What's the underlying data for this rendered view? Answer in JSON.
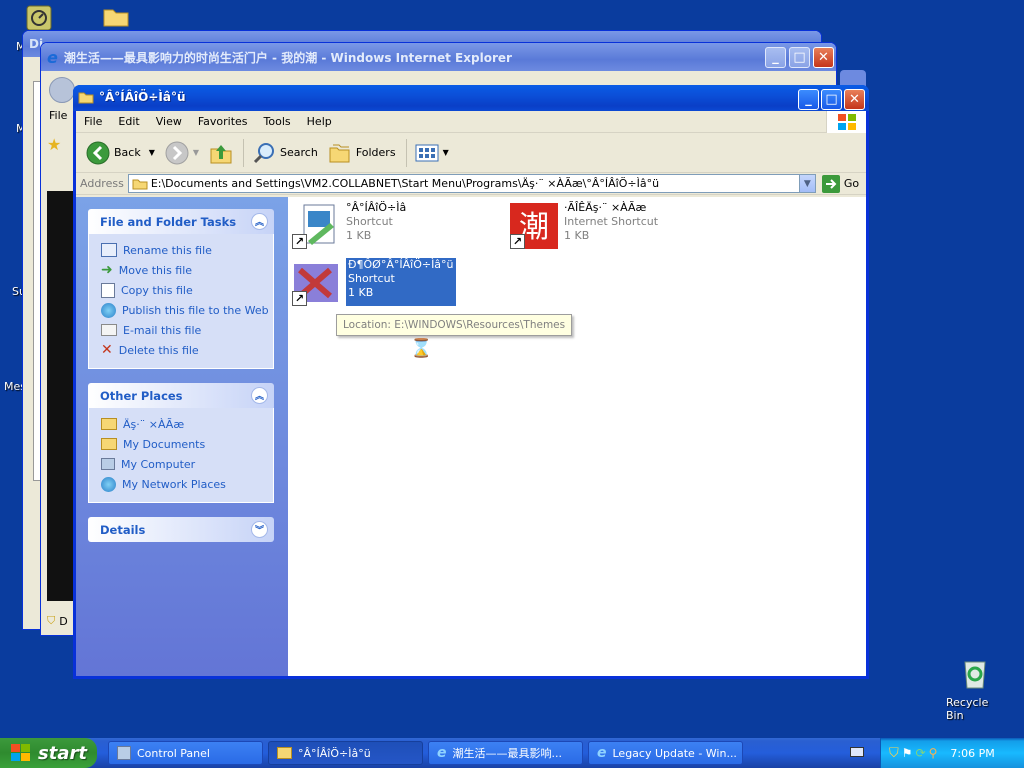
{
  "desktop": {
    "recycle_bin_label": "Recycle Bin",
    "left_stubs": [
      "M",
      "M",
      "Su",
      "Mes"
    ]
  },
  "bg_windows": {
    "back_title": "Di",
    "ie_title": "潮生活——最具影响力的时尚生活门户 - 我的潮 - Windows Internet Explorer",
    "ie_menu_stub": "File",
    "ie_status_stub": "D"
  },
  "explorer": {
    "title": "°Â°ÍÂîÖ÷Ìâ°ü",
    "menu": [
      "File",
      "Edit",
      "View",
      "Favorites",
      "Tools",
      "Help"
    ],
    "toolbar": {
      "back": "Back",
      "search": "Search",
      "folders": "Folders"
    },
    "address": {
      "label": "Address",
      "value": "E:\\Documents and Settings\\VM2.COLLABNET\\Start Menu\\Programs\\Äş·¨ ×ÀÃæ\\°Â°ÍÂîÖ÷Ìâ°ü",
      "go": "Go"
    },
    "file_tasks": {
      "title": "File and Folder Tasks",
      "items": [
        {
          "label": "Rename this file",
          "icon": "rename-icon"
        },
        {
          "label": "Move this file",
          "icon": "move-icon"
        },
        {
          "label": "Copy this file",
          "icon": "copy-icon"
        },
        {
          "label": "Publish this file to the Web",
          "icon": "globe-icon"
        },
        {
          "label": "E-mail this file",
          "icon": "email-icon"
        },
        {
          "label": "Delete this file",
          "icon": "delete-icon"
        }
      ]
    },
    "other_places": {
      "title": "Other Places",
      "items": [
        {
          "label": "Äş·¨ ×ÀÃæ",
          "icon": "folder-icon"
        },
        {
          "label": "My Documents",
          "icon": "my-documents-icon"
        },
        {
          "label": "My Computer",
          "icon": "my-computer-icon"
        },
        {
          "label": "My Network Places",
          "icon": "network-places-icon"
        }
      ]
    },
    "details": {
      "title": "Details"
    },
    "files": [
      {
        "name": "°Â°ÍÂîÖ÷Ìâ",
        "type": "Shortcut",
        "size": "1 KB"
      },
      {
        "name": "·ÃÎÊÄş·¨ ×ÀÃæ",
        "type": "Internet Shortcut",
        "size": "1 KB"
      },
      {
        "name": "Ð¶ÔØ°Â°ÍÂîÖ÷Ìâ°ü",
        "type": "Shortcut",
        "size": "1 KB"
      }
    ],
    "tooltip": "Location: E:\\WINDOWS\\Resources\\Themes"
  },
  "taskbar": {
    "start": "start",
    "tasks": [
      {
        "label": "Control Panel"
      },
      {
        "label": "°Â°ÍÂîÖ÷Ìâ°ü"
      },
      {
        "label": "潮生活——最具影响..."
      },
      {
        "label": "Legacy Update - Win..."
      }
    ],
    "clock": "7:06 PM"
  },
  "colors": {
    "desktop": "#0a3c9e",
    "xp_blue_title": "#0a5ce6",
    "task_link": "#215dc6",
    "selection": "#316ac5"
  }
}
